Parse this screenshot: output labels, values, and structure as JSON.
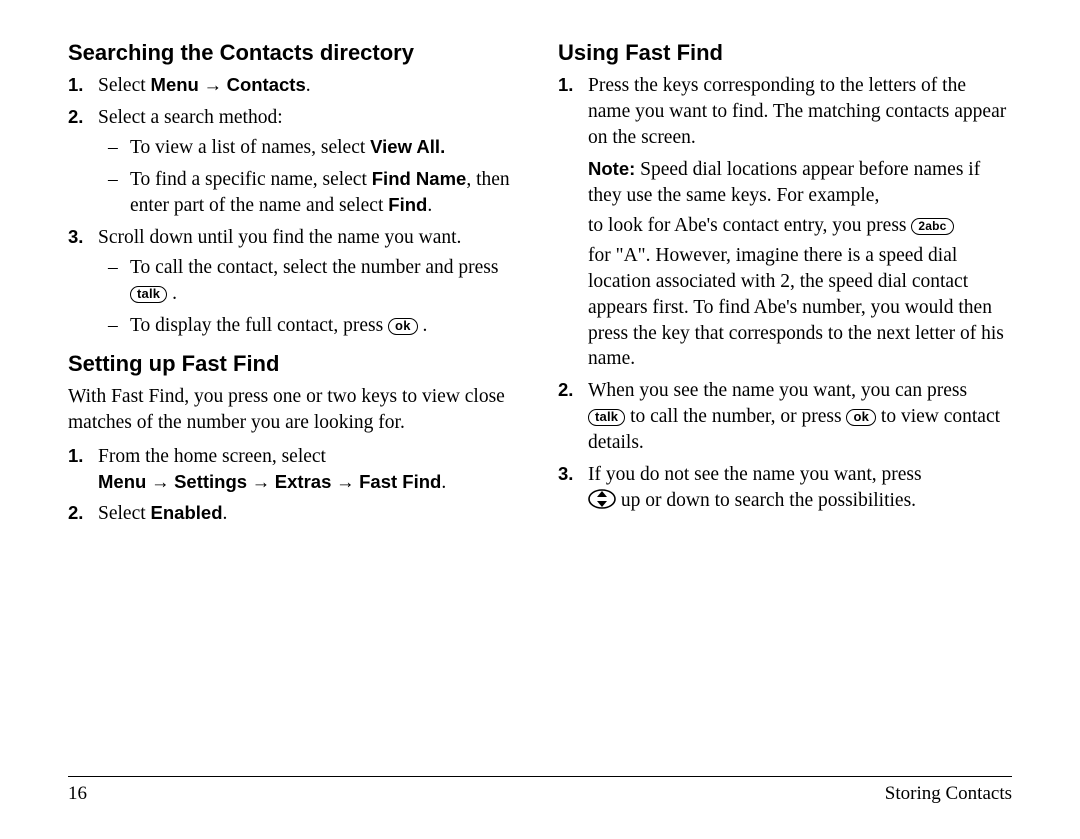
{
  "left": {
    "h1": "Searching the Contacts directory",
    "step1_a": "Select ",
    "step1_b_menu": "Menu",
    "step1_arrow": " → ",
    "step1_c_contacts": "Contacts",
    "step1_d": ".",
    "step2": "Select a search method:",
    "step2_dash1_a": "To view a list of names, select ",
    "step2_dash1_b": "View All.",
    "step2_dash2_a": "To find a specific name, select ",
    "step2_dash2_b": "Find Name",
    "step2_dash2_c": ", then enter part of the name and select ",
    "step2_dash2_d": "Find",
    "step2_dash2_e": ".",
    "step3": "Scroll down until you find the name you want.",
    "step3_dash1_a": "To call the contact, select the number and press ",
    "step3_dash1_key": "talk",
    "step3_dash1_b": " .",
    "step3_dash2_a": "To display the full contact, press ",
    "step3_dash2_key": "ok",
    "step3_dash2_b": " .",
    "h2": "Setting up Fast Find",
    "ff_intro": "With Fast Find, you press one or two keys to view close matches of the number you are looking for.",
    "ff1_a": "From the home screen, select",
    "ff1_path_menu": "Menu",
    "ff1_path_settings": "Settings",
    "ff1_path_extras": "Extras",
    "ff1_path_ff": "Fast Find",
    "ff1_path_end": ".",
    "ff2_a": "Select ",
    "ff2_b": "Enabled",
    "ff2_c": "."
  },
  "right": {
    "h1": "Using Fast Find",
    "step1": "Press the keys corresponding to the letters of the name you want to find. The matching contacts appear on the screen.",
    "note_label": "Note:",
    "note_a": " Speed dial locations appear before names if they use the same keys. For example,",
    "note_b": "to look for Abe's contact entry, you press ",
    "note_key2": "2abc",
    "note_c": "for \"A\". However, imagine there is a speed dial location associated with 2, the speed dial contact appears first. To find Abe's number, you would then press the key that corresponds to the next letter of his name.",
    "step2_a": "When you see the name you want, you can press ",
    "step2_key_talk": "talk",
    "step2_b": " to call the number, or press ",
    "step2_key_ok": "ok",
    "step2_c": " to view contact details.",
    "step3_a": "If you do not see the name you want, press ",
    "step3_b": " up or down to search the possibilities."
  },
  "footer": {
    "page": "16",
    "section": "Storing Contacts"
  },
  "markers": {
    "n1": "1.",
    "n2": "2.",
    "n3": "3."
  }
}
